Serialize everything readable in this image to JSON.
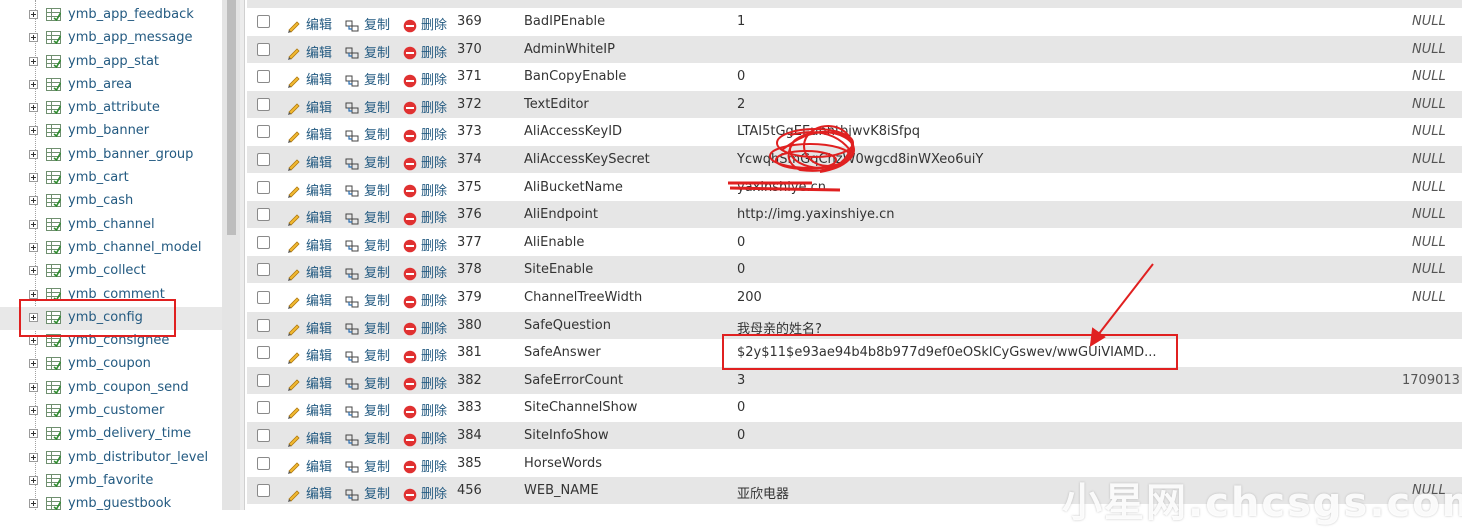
{
  "sidebar": {
    "items": [
      {
        "label": "ymb_app_feedback"
      },
      {
        "label": "ymb_app_message"
      },
      {
        "label": "ymb_app_stat"
      },
      {
        "label": "ymb_area"
      },
      {
        "label": "ymb_attribute"
      },
      {
        "label": "ymb_banner"
      },
      {
        "label": "ymb_banner_group"
      },
      {
        "label": "ymb_cart"
      },
      {
        "label": "ymb_cash"
      },
      {
        "label": "ymb_channel"
      },
      {
        "label": "ymb_channel_model"
      },
      {
        "label": "ymb_collect"
      },
      {
        "label": "ymb_comment"
      },
      {
        "label": "ymb_config",
        "selected": true
      },
      {
        "label": "ymb_consignee"
      },
      {
        "label": "ymb_coupon"
      },
      {
        "label": "ymb_coupon_send"
      },
      {
        "label": "ymb_customer"
      },
      {
        "label": "ymb_delivery_time"
      },
      {
        "label": "ymb_distributor_level"
      },
      {
        "label": "ymb_favorite"
      },
      {
        "label": "ymb_guestbook"
      }
    ]
  },
  "actions": {
    "edit_label": "编辑",
    "copy_label": "复制",
    "delete_label": "删除"
  },
  "table": {
    "rows": [
      {
        "id": "369",
        "name": "BadIPEnable",
        "value": "1",
        "extra": "NULL"
      },
      {
        "id": "370",
        "name": "AdminWhiteIP",
        "value": "",
        "extra": "NULL"
      },
      {
        "id": "371",
        "name": "BanCopyEnable",
        "value": "0",
        "extra": "NULL"
      },
      {
        "id": "372",
        "name": "TextEditor",
        "value": "2",
        "extra": "NULL"
      },
      {
        "id": "373",
        "name": "AliAccessKeyID",
        "value": "LTAI5tGgEEunhtbjwvK8iSfpq",
        "extra": "NULL"
      },
      {
        "id": "374",
        "name": "AliAccessKeySecret",
        "value": "YcwqhSmGqChzW0wgcd8inWXeo6uiY",
        "extra": "NULL"
      },
      {
        "id": "375",
        "name": "AliBucketName",
        "value": "yaxinshiye.cn",
        "extra": "NULL"
      },
      {
        "id": "376",
        "name": "AliEndpoint",
        "value": "http://img.yaxinshiye.cn",
        "extra": "NULL"
      },
      {
        "id": "377",
        "name": "AliEnable",
        "value": "0",
        "extra": "NULL"
      },
      {
        "id": "378",
        "name": "SiteEnable",
        "value": "0",
        "extra": "NULL"
      },
      {
        "id": "379",
        "name": "ChannelTreeWidth",
        "value": "200",
        "extra": "NULL"
      },
      {
        "id": "380",
        "name": "SafeQuestion",
        "value": "我母亲的姓名?",
        "extra": ""
      },
      {
        "id": "381",
        "name": "SafeAnswer",
        "value": "$2y$11$e93ae94b4b8b977d9ef0eOSklCyGswev/wwGUiVIAMD...",
        "extra": ""
      },
      {
        "id": "382",
        "name": "SafeErrorCount",
        "value": "3",
        "extra": "1709013"
      },
      {
        "id": "383",
        "name": "SiteChannelShow",
        "value": "0",
        "extra": ""
      },
      {
        "id": "384",
        "name": "SiteInfoShow",
        "value": "0",
        "extra": ""
      },
      {
        "id": "385",
        "name": "HorseWords",
        "value": "",
        "extra": ""
      },
      {
        "id": "456",
        "name": "WEB_NAME",
        "value": "亚欣电器",
        "extra": "NULL"
      }
    ]
  },
  "watermark": {
    "text": "小星网.chcsgs.com"
  },
  "colors": {
    "link": "#235a81",
    "annotation": "#e02020",
    "row_alt": "#e6e6e6"
  }
}
